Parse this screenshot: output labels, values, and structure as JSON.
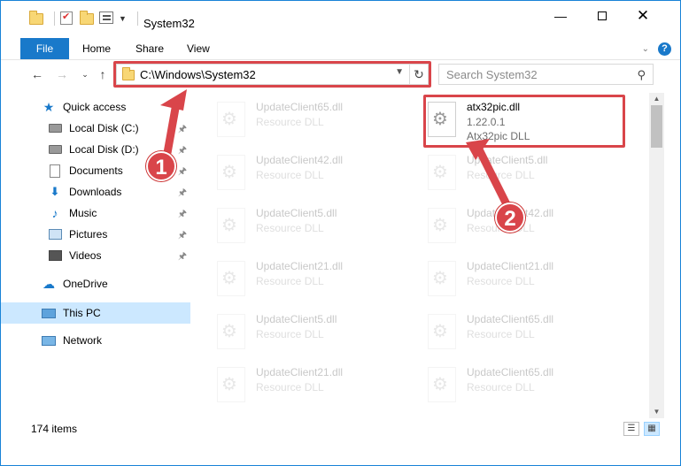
{
  "window": {
    "title": "System32"
  },
  "ribbon": {
    "tabs": [
      "File",
      "Home",
      "Share",
      "View"
    ],
    "help": "?"
  },
  "address": {
    "path": "C:\\Windows\\System32"
  },
  "search": {
    "placeholder": "Search System32"
  },
  "nav": {
    "items": [
      {
        "label": "Quick access",
        "icon": "star-icon"
      },
      {
        "label": "Local Disk (C:)",
        "icon": "drive-icon",
        "pinned": true
      },
      {
        "label": "Local Disk (D:)",
        "icon": "drive-icon",
        "pinned": true
      },
      {
        "label": "Documents",
        "icon": "documents-icon",
        "pinned": true
      },
      {
        "label": "Downloads",
        "icon": "downloads-icon",
        "pinned": true
      },
      {
        "label": "Music",
        "icon": "music-icon",
        "pinned": true
      },
      {
        "label": "Pictures",
        "icon": "pictures-icon",
        "pinned": true
      },
      {
        "label": "Videos",
        "icon": "videos-icon",
        "pinned": true
      },
      {
        "label": "OneDrive",
        "icon": "cloud-icon"
      },
      {
        "label": "This PC",
        "icon": "computer-icon",
        "selected": true
      },
      {
        "label": "Network",
        "icon": "network-icon"
      }
    ]
  },
  "files": {
    "highlighted": {
      "name": "atx32pic.dll",
      "version": "1.22.0.1",
      "description": "Atx32pic DLL"
    },
    "left_column": [
      {
        "name": "UpdateClient65.dll",
        "type": "Resource DLL"
      },
      {
        "name": "UpdateClient42.dll",
        "type": "Resource DLL"
      },
      {
        "name": "UpdateClient5.dll",
        "type": "Resource DLL"
      },
      {
        "name": "UpdateClient21.dll",
        "type": "Resource DLL"
      },
      {
        "name": "UpdateClient5.dll",
        "type": "Resource DLL"
      },
      {
        "name": "UpdateClient21.dll",
        "type": "Resource DLL"
      }
    ],
    "right_column": [
      {
        "name": "UpdateClient5.dll",
        "type": "Resource DLL"
      },
      {
        "name": "UpdateClient42.dll",
        "type": "Resource DLL"
      },
      {
        "name": "UpdateClient21.dll",
        "type": "Resource DLL"
      },
      {
        "name": "UpdateClient65.dll",
        "type": "Resource DLL"
      },
      {
        "name": "UpdateClient65.dll",
        "type": "Resource DLL"
      }
    ]
  },
  "status": {
    "count": "174 items"
  },
  "callouts": [
    "1",
    "2"
  ],
  "colors": {
    "accent": "#1979ca",
    "highlight": "#d9454a",
    "selection": "#cce8ff"
  }
}
